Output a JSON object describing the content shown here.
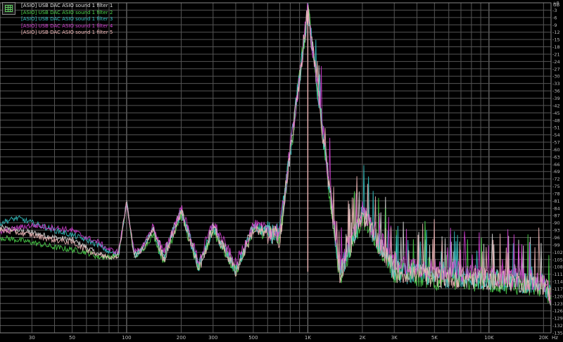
{
  "chart_data": {
    "type": "line",
    "xscale": "log",
    "xlim": [
      20,
      22000
    ],
    "ylim": [
      -135,
      0
    ],
    "xunit": "Hz",
    "yunit": "dB",
    "grid": true,
    "legend_position": "top-left",
    "x_ticks": [
      {
        "value": 30,
        "label": "30"
      },
      {
        "value": 50,
        "label": "50"
      },
      {
        "value": 100,
        "label": "100"
      },
      {
        "value": 200,
        "label": "200"
      },
      {
        "value": 300,
        "label": "300"
      },
      {
        "value": 500,
        "label": "500"
      },
      {
        "value": 1000,
        "label": "1K"
      },
      {
        "value": 2000,
        "label": "2K"
      },
      {
        "value": 3000,
        "label": "3K"
      },
      {
        "value": 5000,
        "label": "5K"
      },
      {
        "value": 10000,
        "label": "10K"
      },
      {
        "value": 20000,
        "label": "20K"
      }
    ],
    "y_ticks": [
      0,
      -3,
      -6,
      -9,
      -12,
      -15,
      -18,
      -21,
      -24,
      -27,
      -30,
      -33,
      -36,
      -39,
      -42,
      -45,
      -48,
      -51,
      -54,
      -57,
      -60,
      -63,
      -66,
      -69,
      -72,
      -75,
      -78,
      -81,
      -84,
      -87,
      -90,
      -93,
      -96,
      -99,
      -102,
      -105,
      -108,
      -111,
      -114,
      -117,
      -120,
      -123,
      -126,
      -129,
      -132,
      -135
    ],
    "y_tick_labels": [
      "+0",
      "-3",
      "-6",
      "-9",
      "-12",
      "-15",
      "-18",
      "-21",
      "-24",
      "-27",
      "-30",
      "-33",
      "-36",
      "-39",
      "-42",
      "-45",
      "-48",
      "-51",
      "-54",
      "-57",
      "-60",
      "-63",
      "-66",
      "-69",
      "-72",
      "-75",
      "-78",
      "-81",
      "-84",
      "-87",
      "-90",
      "-93",
      "-96",
      "-99",
      "-102",
      "-105",
      "-108",
      "-111",
      "-114",
      "-117",
      "-120",
      "-123",
      "-126",
      "-129",
      "-132",
      "-135"
    ],
    "fundamental": {
      "freq": 1000,
      "level": -3
    },
    "series": [
      {
        "name": "[ASIO] USB DAC ASIO sound 1 filter 1",
        "color": "#e0e0e0",
        "points": [
          [
            20,
            -92
          ],
          [
            25,
            -93
          ],
          [
            30,
            -94
          ],
          [
            40,
            -96
          ],
          [
            50,
            -97
          ],
          [
            60,
            -100
          ],
          [
            70,
            -103
          ],
          [
            80,
            -104
          ],
          [
            90,
            -104
          ],
          [
            100,
            -81
          ],
          [
            110,
            -103
          ],
          [
            120,
            -101
          ],
          [
            140,
            -92
          ],
          [
            160,
            -104
          ],
          [
            200,
            -85
          ],
          [
            250,
            -108
          ],
          [
            300,
            -91
          ],
          [
            400,
            -109
          ],
          [
            500,
            -92
          ],
          [
            700,
            -95
          ],
          [
            1000,
            -3
          ],
          [
            1500,
            -111
          ],
          [
            2000,
            -86
          ],
          [
            3000,
            -109
          ],
          [
            5000,
            -112
          ],
          [
            10000,
            -113
          ],
          [
            20000,
            -115
          ],
          [
            22000,
            -120
          ]
        ]
      },
      {
        "name": "[ASIO] USB DAC ASIO sound 1 filter 2",
        "color": "#4ed84e",
        "points": [
          [
            20,
            -96
          ],
          [
            25,
            -97
          ],
          [
            30,
            -98
          ],
          [
            40,
            -100
          ],
          [
            50,
            -101
          ],
          [
            60,
            -102
          ],
          [
            70,
            -104
          ],
          [
            80,
            -104
          ],
          [
            90,
            -103
          ],
          [
            100,
            -82
          ],
          [
            110,
            -104
          ],
          [
            120,
            -102
          ],
          [
            140,
            -95
          ],
          [
            160,
            -105
          ],
          [
            200,
            -86
          ],
          [
            250,
            -109
          ],
          [
            300,
            -93
          ],
          [
            400,
            -110
          ],
          [
            500,
            -93
          ],
          [
            700,
            -96
          ],
          [
            1000,
            -3
          ],
          [
            1500,
            -112
          ],
          [
            2000,
            -87
          ],
          [
            3000,
            -110
          ],
          [
            5000,
            -113
          ],
          [
            10000,
            -114
          ],
          [
            20000,
            -116
          ],
          [
            22000,
            -121
          ]
        ]
      },
      {
        "name": "[ASIO] USB DAC ASIO sound 1 filter 3",
        "color": "#36c6c6",
        "points": [
          [
            20,
            -90
          ],
          [
            25,
            -88
          ],
          [
            30,
            -90
          ],
          [
            40,
            -93
          ],
          [
            50,
            -95
          ],
          [
            60,
            -97
          ],
          [
            70,
            -99
          ],
          [
            80,
            -102
          ],
          [
            90,
            -103
          ],
          [
            100,
            -81
          ],
          [
            110,
            -104
          ],
          [
            120,
            -101
          ],
          [
            140,
            -93
          ],
          [
            160,
            -105
          ],
          [
            200,
            -85
          ],
          [
            250,
            -108
          ],
          [
            300,
            -92
          ],
          [
            400,
            -110
          ],
          [
            500,
            -92
          ],
          [
            700,
            -95
          ],
          [
            1000,
            -3
          ],
          [
            1500,
            -111
          ],
          [
            2000,
            -86
          ],
          [
            3000,
            -110
          ],
          [
            5000,
            -112
          ],
          [
            10000,
            -113
          ],
          [
            20000,
            -115
          ],
          [
            22000,
            -120
          ]
        ]
      },
      {
        "name": "[ASIO] USB DAC ASIO sound 1 filter 4",
        "color": "#d43fd4",
        "points": [
          [
            20,
            -94
          ],
          [
            25,
            -92
          ],
          [
            30,
            -91
          ],
          [
            40,
            -92
          ],
          [
            50,
            -93
          ],
          [
            60,
            -96
          ],
          [
            70,
            -98
          ],
          [
            80,
            -101
          ],
          [
            90,
            -102
          ],
          [
            100,
            -82
          ],
          [
            110,
            -102
          ],
          [
            120,
            -101
          ],
          [
            140,
            -91
          ],
          [
            160,
            -103
          ],
          [
            200,
            -84
          ],
          [
            250,
            -106
          ],
          [
            300,
            -90
          ],
          [
            400,
            -107
          ],
          [
            500,
            -91
          ],
          [
            700,
            -94
          ],
          [
            1000,
            -3
          ],
          [
            1500,
            -108
          ],
          [
            2000,
            -85
          ],
          [
            3000,
            -106
          ],
          [
            5000,
            -109
          ],
          [
            10000,
            -111
          ],
          [
            20000,
            -114
          ],
          [
            22000,
            -119
          ]
        ]
      },
      {
        "name": "[ASIO] USB DAC ASIO sound 1 filter 5",
        "color": "#f2b8b8",
        "points": [
          [
            20,
            -93
          ],
          [
            25,
            -94
          ],
          [
            30,
            -95
          ],
          [
            40,
            -97
          ],
          [
            50,
            -98
          ],
          [
            60,
            -101
          ],
          [
            70,
            -103
          ],
          [
            80,
            -104
          ],
          [
            90,
            -103
          ],
          [
            100,
            -81
          ],
          [
            110,
            -104
          ],
          [
            120,
            -102
          ],
          [
            140,
            -93
          ],
          [
            160,
            -105
          ],
          [
            200,
            -85
          ],
          [
            250,
            -109
          ],
          [
            300,
            -92
          ],
          [
            400,
            -110
          ],
          [
            500,
            -93
          ],
          [
            700,
            -96
          ],
          [
            1000,
            -3
          ],
          [
            1500,
            -111
          ],
          [
            2000,
            -86
          ],
          [
            3000,
            -110
          ],
          [
            5000,
            -112
          ],
          [
            10000,
            -113
          ],
          [
            20000,
            -115
          ],
          [
            22000,
            -120
          ]
        ]
      }
    ]
  }
}
